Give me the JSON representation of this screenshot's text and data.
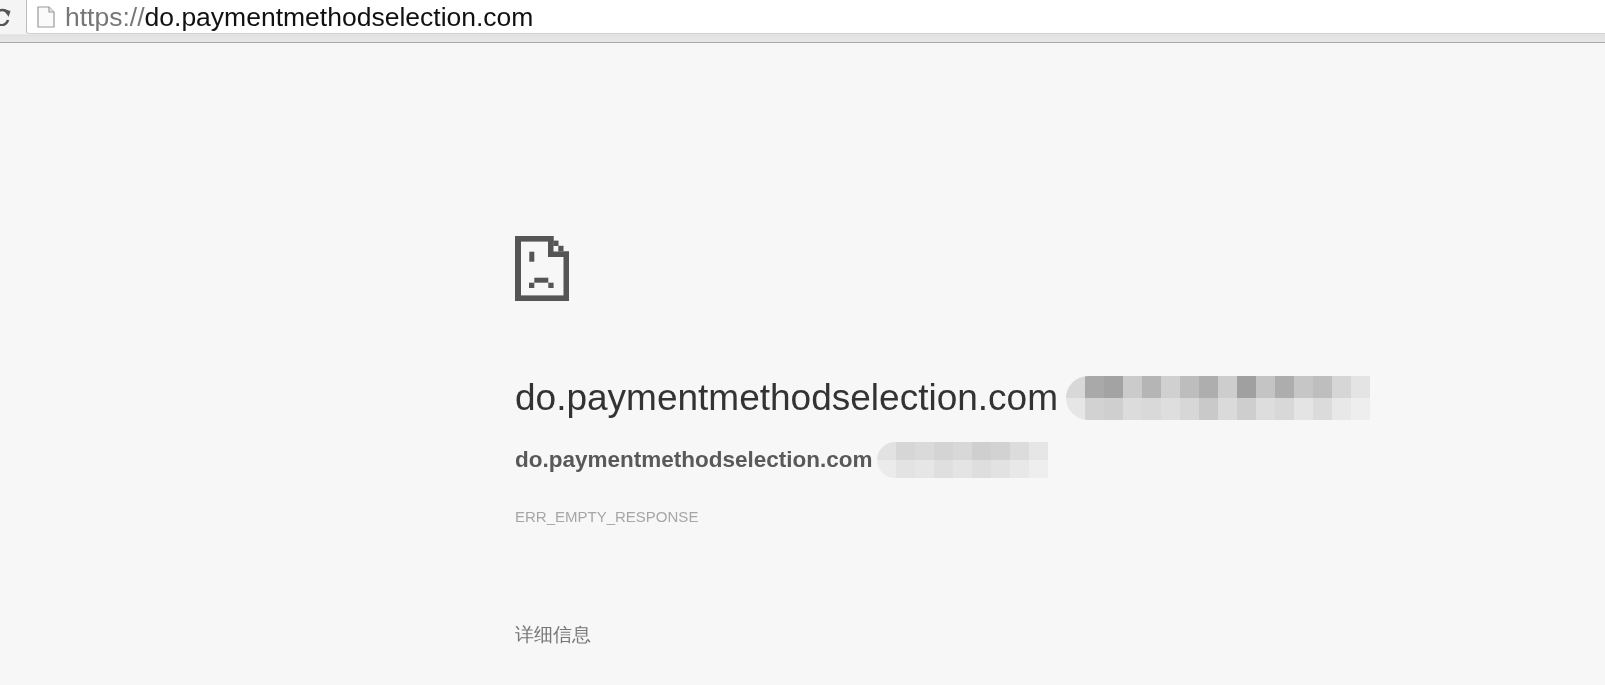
{
  "address_bar": {
    "scheme": "https://",
    "host": "do.paymentmethodselection.com"
  },
  "error_page": {
    "title": {
      "text": "do.paymentmethodselection.com",
      "redacted": true
    },
    "subtitle": {
      "text": "do.paymentmethodselection.com",
      "redacted": true
    },
    "error_code": "ERR_EMPTY_RESPONSE",
    "details_button": "详细信息"
  }
}
